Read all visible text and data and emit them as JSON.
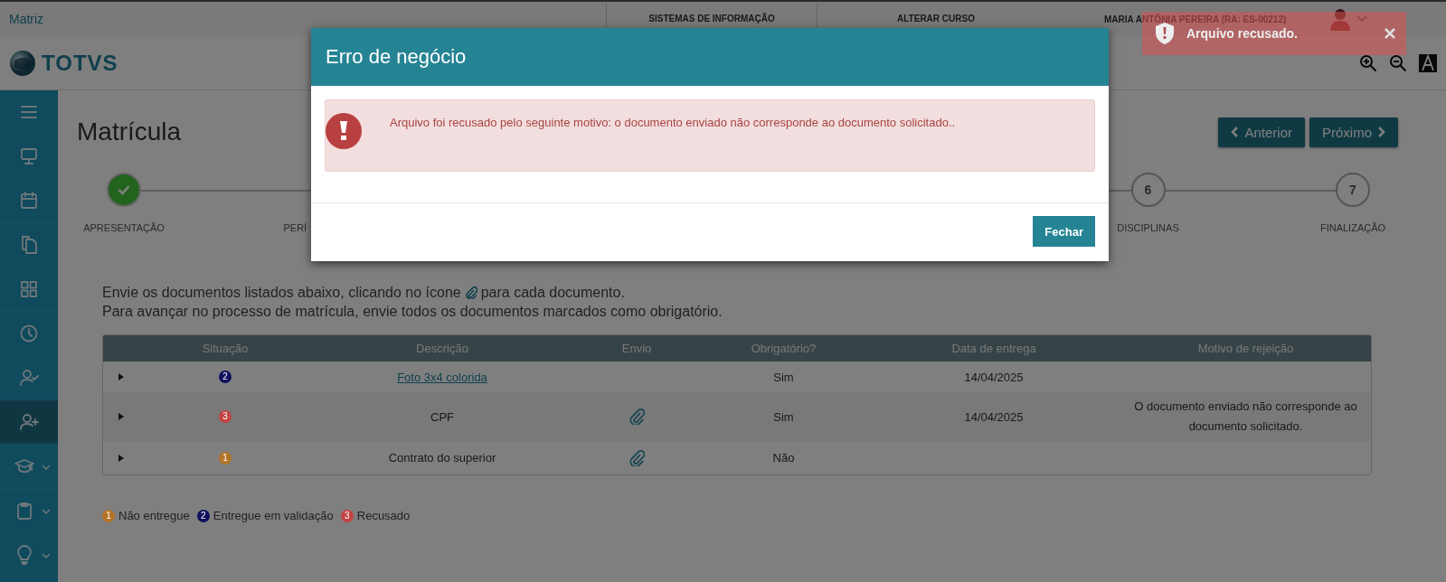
{
  "topbar": {
    "home": "Matriz",
    "links": [
      "SISTEMAS DE INFORMAÇÃO",
      "ALTERAR CURSO"
    ],
    "user": "MARIA ANTÔNIA PEREIRA (RA: ES-00212)"
  },
  "logo": {
    "text": "TOTVS"
  },
  "sidebar": {
    "items": [
      {
        "selected": false,
        "has_submenu": false
      },
      {
        "selected": false,
        "has_submenu": false
      },
      {
        "selected": false,
        "has_submenu": false
      },
      {
        "selected": false,
        "has_submenu": false
      },
      {
        "selected": false,
        "has_submenu": false
      },
      {
        "selected": false,
        "has_submenu": false
      },
      {
        "selected": false,
        "has_submenu": false
      },
      {
        "selected": true,
        "has_submenu": false
      },
      {
        "selected": false,
        "has_submenu": true
      },
      {
        "selected": false,
        "has_submenu": true
      },
      {
        "selected": false,
        "has_submenu": true
      }
    ]
  },
  "page": {
    "title": "Matrícula",
    "buttons": [
      {
        "label": "Anterior",
        "kind": "prev"
      },
      {
        "label": "Próximo",
        "kind": "next"
      }
    ]
  },
  "steps": [
    {
      "done": true,
      "label": "APRESENTAÇÃO",
      "cut_off": false
    },
    {
      "done": false,
      "label": "PERÍ",
      "cut_off": true
    },
    {
      "number": "6",
      "done": false,
      "label": "DISCIPLINAS",
      "cut_off": false
    },
    {
      "number": "7",
      "done": false,
      "label": "FINALIZAÇÃO",
      "cut_off": false
    }
  ],
  "instructions": {
    "line_1_before_icon": "Envie os documentos listados abaixo, clicando no ícone",
    "line_1_after_icon": "para cada documento.",
    "line_2": "Para avançar no processo de matrícula, envie todos os documentos marcados como obrigatório."
  },
  "table": {
    "columns": [
      "",
      "Situação",
      "Descrição",
      "Envio",
      "Obrigatório?",
      "Data de entrega",
      "Motivo de rejeição"
    ],
    "rows": [
      {
        "status": "2",
        "color": "#10105c",
        "description": "Foto 3x4 colorida",
        "description_link": true,
        "attachment": false,
        "required": "Sim",
        "date": "14/04/2025",
        "reason": ""
      },
      {
        "status": "3",
        "color": "#c44444",
        "description": "CPF",
        "description_link": false,
        "attachment": true,
        "required": "Sim",
        "date": "14/04/2025",
        "reason": "O documento enviado não corresponde ao documento solicitado."
      },
      {
        "status": "1",
        "color": "#b47428",
        "description": "Contrato do superior",
        "description_link": false,
        "attachment": true,
        "required": "Não",
        "date": "",
        "reason": ""
      }
    ]
  },
  "legend": [
    {
      "badge": "1",
      "color": "#b47428",
      "label": "Não entregue"
    },
    {
      "badge": "2",
      "color": "#10105c",
      "label": "Entregue em validação"
    },
    {
      "badge": "3",
      "color": "#c44444",
      "label": "Recusado"
    }
  ],
  "modal": {
    "title": "Erro de negócio",
    "message": "Arquivo foi recusado pelo seguinte motivo: o documento enviado não corresponde ao documento solicitado..",
    "button": "Fechar"
  },
  "toast": {
    "message": "Arquivo recusado."
  }
}
